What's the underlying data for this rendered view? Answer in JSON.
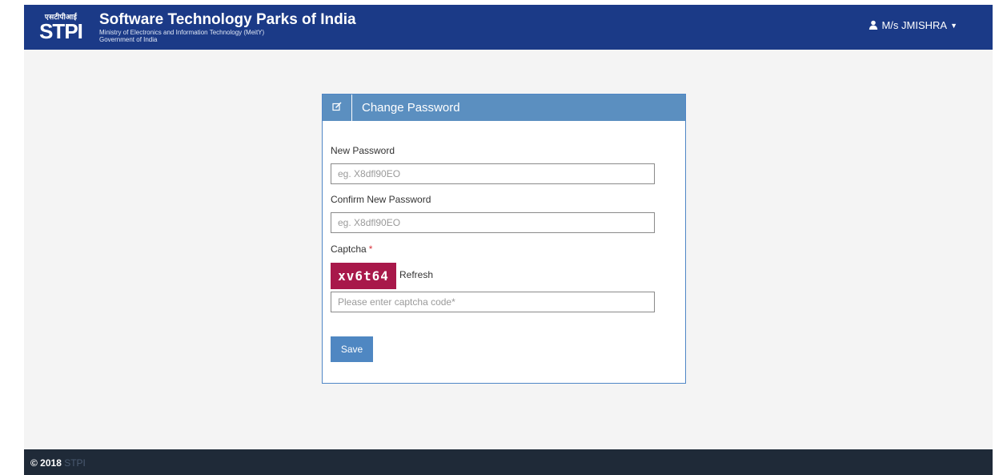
{
  "header": {
    "logo_devanagari": "एसटीपीआई",
    "logo_mark": "STPI",
    "org_name": "Software Technology Parks of India",
    "org_subtitle_1": "Ministry of Electronics and Information Technology (MeitY)",
    "org_subtitle_2": "Government of India",
    "user_label": "M/s JMISHRA",
    "user_icon": "user-icon",
    "menu_icon": "caret-down-icon"
  },
  "panel": {
    "icon": "edit-icon",
    "title": "Change Password",
    "new_password_label": "New Password",
    "new_password_placeholder": "eg. X8dfl90EO",
    "new_password_value": "",
    "confirm_password_label": "Confirm New Password",
    "confirm_password_placeholder": "eg. X8dfl90EO",
    "confirm_password_value": "",
    "captcha_label": "Captcha",
    "captcha_required_marker": "*",
    "captcha_text": "xv6t64",
    "refresh_label": "Refresh",
    "captcha_input_placeholder": "Please enter captcha code*",
    "captcha_input_value": "",
    "save_label": "Save"
  },
  "footer": {
    "copyright": "© 2018",
    "brand": "STPI"
  },
  "colors": {
    "header_bg": "#1b3a87",
    "panel_header_bg": "#5b8fc0",
    "captcha_bg": "#a8184a",
    "button_bg": "#4f87c2",
    "footer_bg": "#1f2a38"
  }
}
